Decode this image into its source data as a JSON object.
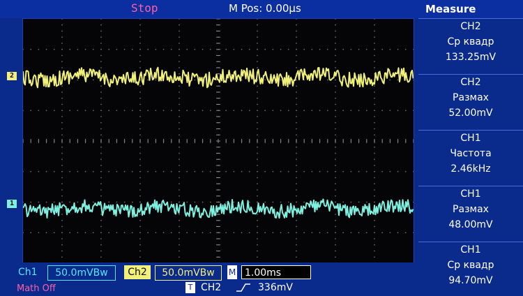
{
  "header": {
    "status": "Stop",
    "horizontal_position": "M Pos: 0.00µs"
  },
  "traces": {
    "ch2_marker": "2",
    "ch1_marker": "1",
    "ch2_color": "#f0f07a",
    "ch1_color": "#7ff0e0"
  },
  "measure": {
    "title": "Measure",
    "items": [
      {
        "channel": "CH2",
        "type": "Ср квадр",
        "value": "133.25mV"
      },
      {
        "channel": "CH2",
        "type": "Размах",
        "value": "52.00mV"
      },
      {
        "channel": "CH1",
        "type": "Частота",
        "value": "2.46kHz"
      },
      {
        "channel": "CH1",
        "type": "Размах",
        "value": "48.00mV"
      },
      {
        "channel": "CH1",
        "type": "Ср квадр",
        "value": "94.70mV"
      }
    ]
  },
  "bottom": {
    "ch1_label": "Ch1",
    "ch1_scale": "50.0mVBw",
    "ch2_label": "Ch2",
    "ch2_scale": "50.0mVBw",
    "time_label": "M",
    "time_scale": "1.00ms",
    "math": "Math Off",
    "trigger_label": "T",
    "trigger_source": "CH2",
    "trigger_edge_icon": "rising-edge-icon",
    "trigger_level": "336mV"
  }
}
